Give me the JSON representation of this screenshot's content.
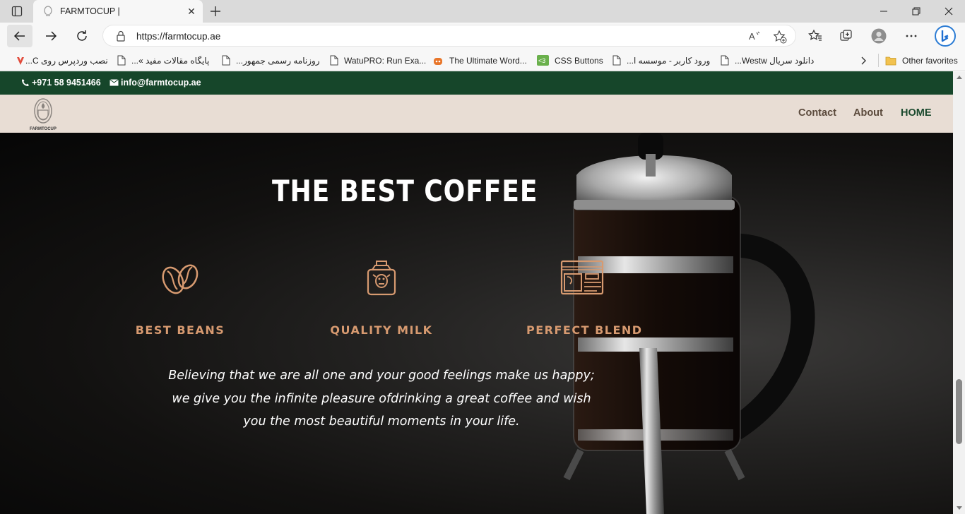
{
  "browser": {
    "tab_title": "FARMTOCUP |",
    "url": "https://farmtocup.ae",
    "bookmarks": [
      {
        "label": "نصب وردپرس روی C...",
        "icon": "red-logo-icon"
      },
      {
        "label": "پایگاه مقالات مفید »...",
        "icon": "page-icon"
      },
      {
        "label": "روزنامه رسمی جمهور...",
        "icon": "page-icon"
      },
      {
        "label": "WatuPRO: Run Exa...",
        "icon": "page-icon"
      },
      {
        "label": "The Ultimate Word...",
        "icon": "orange-robot-icon"
      },
      {
        "label": "CSS Buttons",
        "icon": "green-logo-icon"
      },
      {
        "label": "ورود کاربر - موسسه ا...",
        "icon": "page-icon"
      },
      {
        "label": "دانلود سریال Westw...",
        "icon": "page-icon"
      }
    ],
    "other_favorites": "Other favorites"
  },
  "site": {
    "phone": "+971 58 9451466",
    "email": "info@farmtocup.ae",
    "logo_text": "FARMTOCUP",
    "nav": {
      "contact": "Contact",
      "about": "About",
      "home": "HOME"
    },
    "hero": {
      "title": "THE BEST COFFEE",
      "features": [
        {
          "label": "BEST BEANS",
          "icon": "coffee-bean-icon"
        },
        {
          "label": "QUALITY MILK",
          "icon": "milk-carton-icon"
        },
        {
          "label": "PERFECT BLEND",
          "icon": "coffee-machine-icon"
        }
      ],
      "tagline": "Believing that we are all one and your good feelings make us happy; we give you the infinite pleasure ofdrinking a great coffee and wish you the most beautiful moments in your life."
    }
  },
  "colors": {
    "topbar": "#16462a",
    "header": "#e8ddd4",
    "accent": "#d79a70"
  }
}
